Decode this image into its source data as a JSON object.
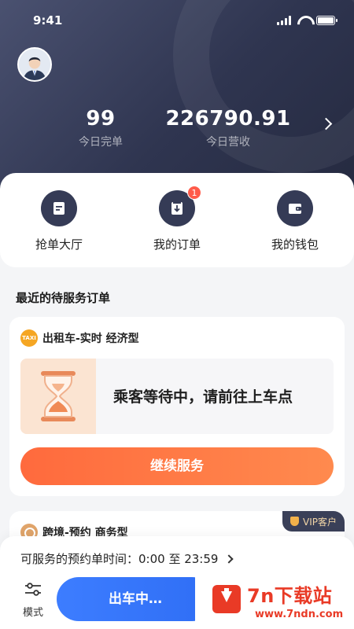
{
  "status_bar": {
    "time": "9:41"
  },
  "stats": {
    "completed_value": "99",
    "completed_label": "今日完单",
    "revenue_value": "226790.91",
    "revenue_label": "今日营收"
  },
  "quick_actions": [
    {
      "label": "抢单大厅",
      "icon": "order-hall-icon"
    },
    {
      "label": "我的订单",
      "icon": "my-orders-icon",
      "badge": "1"
    },
    {
      "label": "我的钱包",
      "icon": "wallet-icon"
    }
  ],
  "section_title": "最近的待服务订单",
  "order_card": {
    "badge_text": "TAXI",
    "type": "出租车-实时 经济型",
    "status": "乘客等待中，请前往上车点",
    "cta": "继续服务"
  },
  "order_card_2": {
    "type": "跨境-预约 商务型",
    "vip_label": "VIP客户"
  },
  "bottom_bar": {
    "available_time": "可服务的预约单时间：0:00 至 23:59",
    "mode_label": "模式",
    "go_button": "出车中…"
  },
  "watermark": {
    "title": "7n下载站",
    "url": "www.7ndn.com"
  },
  "colors": {
    "accent_orange": "#ff6a3d",
    "accent_blue": "#3d7dff",
    "hero_dark": "#2f3550"
  }
}
